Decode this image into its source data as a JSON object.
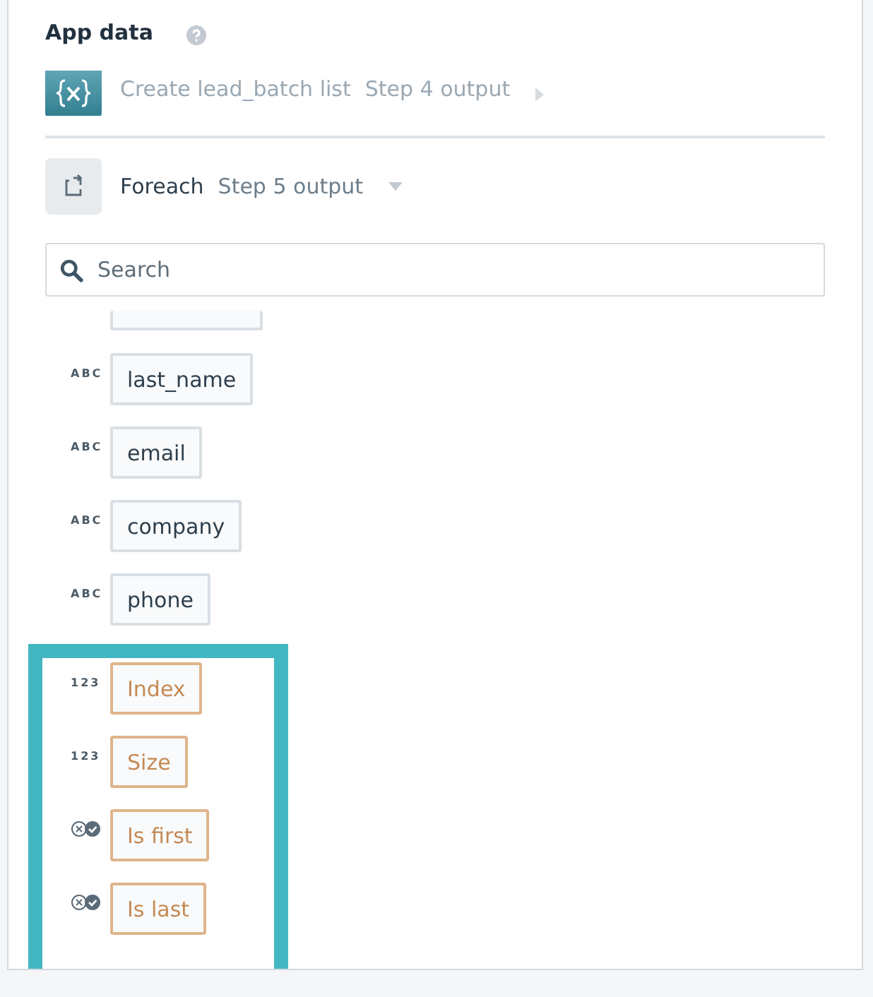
{
  "heading": {
    "title": "App data"
  },
  "steps": [
    {
      "kind": "variables",
      "name": "Create lead_batch list",
      "output": "Step 4 output",
      "expanded": false,
      "dimmed": true
    },
    {
      "kind": "foreach",
      "name": "Foreach",
      "output": "Step 5 output",
      "expanded": true,
      "dimmed": false
    }
  ],
  "search": {
    "placeholder": "Search"
  },
  "fields": [
    {
      "kind": "text",
      "type_label": "ABC",
      "label": "last_name"
    },
    {
      "kind": "text",
      "type_label": "ABC",
      "label": "email"
    },
    {
      "kind": "text",
      "type_label": "ABC",
      "label": "company"
    },
    {
      "kind": "text",
      "type_label": "ABC",
      "label": "phone"
    }
  ],
  "highlighted_fields": [
    {
      "kind": "number",
      "type_label": "123",
      "label": "Index"
    },
    {
      "kind": "number",
      "type_label": "123",
      "label": "Size"
    },
    {
      "kind": "boolean",
      "label": "Is first"
    },
    {
      "kind": "boolean",
      "label": "Is last"
    }
  ]
}
